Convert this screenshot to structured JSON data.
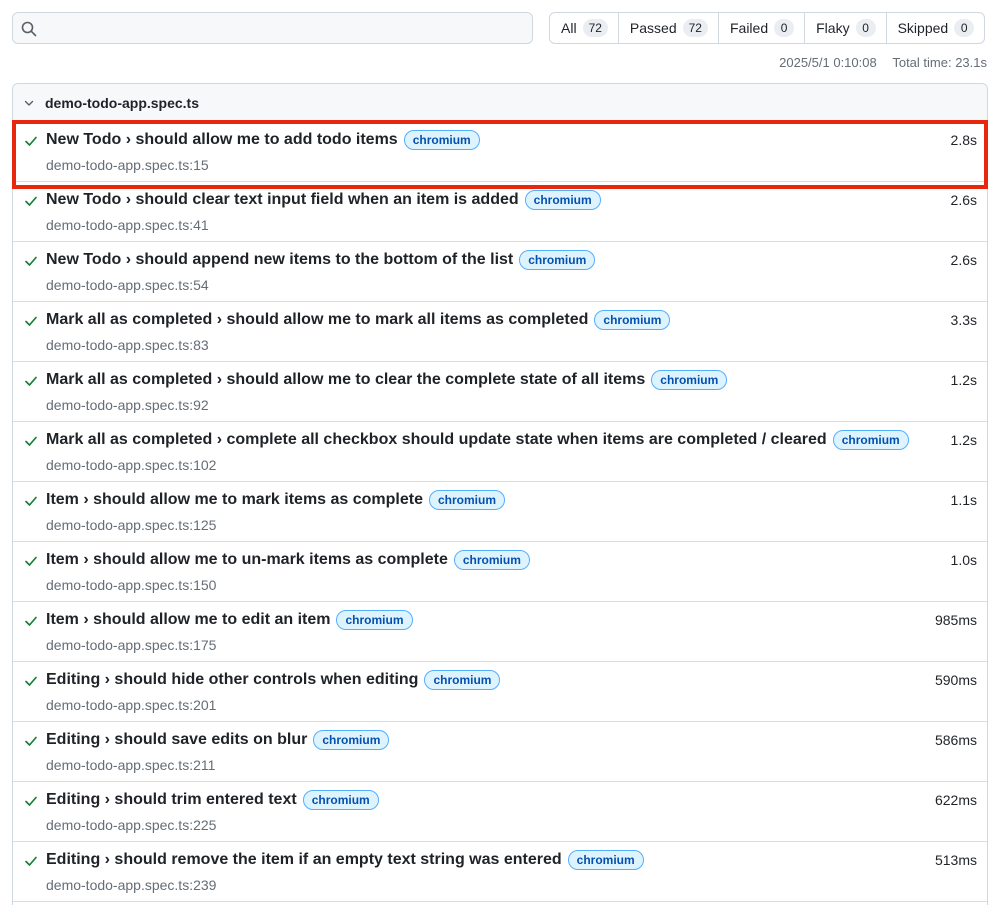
{
  "search": {
    "placeholder": "",
    "value": ""
  },
  "filters": [
    {
      "label": "All",
      "count": "72"
    },
    {
      "label": "Passed",
      "count": "72"
    },
    {
      "label": "Failed",
      "count": "0"
    },
    {
      "label": "Flaky",
      "count": "0"
    },
    {
      "label": "Skipped",
      "count": "0"
    }
  ],
  "meta": {
    "timestamp": "2025/5/1 0:10:08",
    "total_time": "Total time: 23.1s"
  },
  "file": {
    "name": "demo-todo-app.spec.ts"
  },
  "tests": [
    {
      "title": "New Todo › should allow me to add todo items",
      "tag": "chromium",
      "location": "demo-todo-app.spec.ts:15",
      "duration": "2.8s"
    },
    {
      "title": "New Todo › should clear text input field when an item is added",
      "tag": "chromium",
      "location": "demo-todo-app.spec.ts:41",
      "duration": "2.6s"
    },
    {
      "title": "New Todo › should append new items to the bottom of the list",
      "tag": "chromium",
      "location": "demo-todo-app.spec.ts:54",
      "duration": "2.6s"
    },
    {
      "title": "Mark all as completed › should allow me to mark all items as completed",
      "tag": "chromium",
      "location": "demo-todo-app.spec.ts:83",
      "duration": "3.3s"
    },
    {
      "title": "Mark all as completed › should allow me to clear the complete state of all items",
      "tag": "chromium",
      "location": "demo-todo-app.spec.ts:92",
      "duration": "1.2s"
    },
    {
      "title": "Mark all as completed › complete all checkbox should update state when items are completed / cleared",
      "tag": "chromium",
      "location": "demo-todo-app.spec.ts:102",
      "duration": "1.2s"
    },
    {
      "title": "Item › should allow me to mark items as complete",
      "tag": "chromium",
      "location": "demo-todo-app.spec.ts:125",
      "duration": "1.1s"
    },
    {
      "title": "Item › should allow me to un-mark items as complete",
      "tag": "chromium",
      "location": "demo-todo-app.spec.ts:150",
      "duration": "1.0s"
    },
    {
      "title": "Item › should allow me to edit an item",
      "tag": "chromium",
      "location": "demo-todo-app.spec.ts:175",
      "duration": "985ms"
    },
    {
      "title": "Editing › should hide other controls when editing",
      "tag": "chromium",
      "location": "demo-todo-app.spec.ts:201",
      "duration": "590ms"
    },
    {
      "title": "Editing › should save edits on blur",
      "tag": "chromium",
      "location": "demo-todo-app.spec.ts:211",
      "duration": "586ms"
    },
    {
      "title": "Editing › should trim entered text",
      "tag": "chromium",
      "location": "demo-todo-app.spec.ts:225",
      "duration": "622ms"
    },
    {
      "title": "Editing › should remove the item if an empty text string was entered",
      "tag": "chromium",
      "location": "demo-todo-app.spec.ts:239",
      "duration": "513ms"
    }
  ],
  "colors": {
    "pass": "#1a7f37",
    "tag_bg": "#ddf4ff",
    "tag_border": "#54aeff",
    "highlight": "#e8270f"
  }
}
